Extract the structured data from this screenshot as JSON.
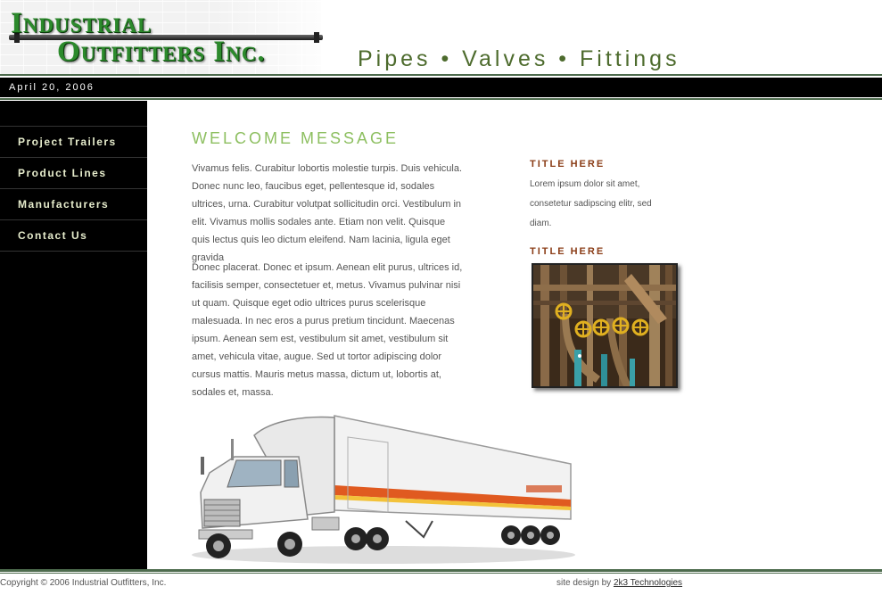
{
  "header": {
    "logo_line1": "Industrial",
    "logo_line2": "Outfitters Inc.",
    "tagline": "Pipes • Valves • Fittings"
  },
  "datebar": {
    "date": "April 20, 2006"
  },
  "sidebar": {
    "items": [
      {
        "label": "Project Trailers"
      },
      {
        "label": "Product Lines"
      },
      {
        "label": "Manufacturers"
      },
      {
        "label": "Contact Us"
      }
    ]
  },
  "main": {
    "heading": "WELCOME MESSAGE",
    "paragraphs": [
      "Vivamus felis. Curabitur lobortis molestie turpis. Duis vehicula. Donec nunc leo, faucibus eget, pellentesque id, sodales ultrices, urna. Curabitur volutpat sollicitudin orci. Vestibulum in elit. Vivamus mollis sodales ante. Etiam non velit. Quisque quis lectus quis leo dictum eleifend. Nam lacinia, ligula eget gravida",
      "Donec placerat. Donec et ipsum. Aenean elit purus, ultrices id, facilisis semper, consectetuer et, metus. Vivamus pulvinar nisi ut quam. Quisque eget odio ultrices purus scelerisque malesuada. In nec eros a purus pretium tincidunt. Maecenas ipsum. Aenean sem est, vestibulum sit amet, vestibulum sit amet, vehicula vitae, augue. Sed ut tortor adipiscing dolor cursus mattis. Mauris metus massa, dictum ut, lobortis at, sodales et, massa."
    ]
  },
  "aside": {
    "title1": "TITLE HERE",
    "text1": "Lorem ipsum dolor sit amet, consetetur sadipscing elitr, sed diam.",
    "title2": "TITLE HERE"
  },
  "footer": {
    "copyright": "Copyright © 2006 Industrial Outfitters, Inc.",
    "design_prefix": "site design by",
    "design_link": "2k3 Technologies"
  },
  "colors": {
    "nav_bg": "#000000",
    "nav_text": "#e6eccc",
    "heading_green": "#8dbf60",
    "tagline_green": "#4d6b2d",
    "aside_title": "#8a3c16",
    "rule_green": "#4d6b4d"
  }
}
